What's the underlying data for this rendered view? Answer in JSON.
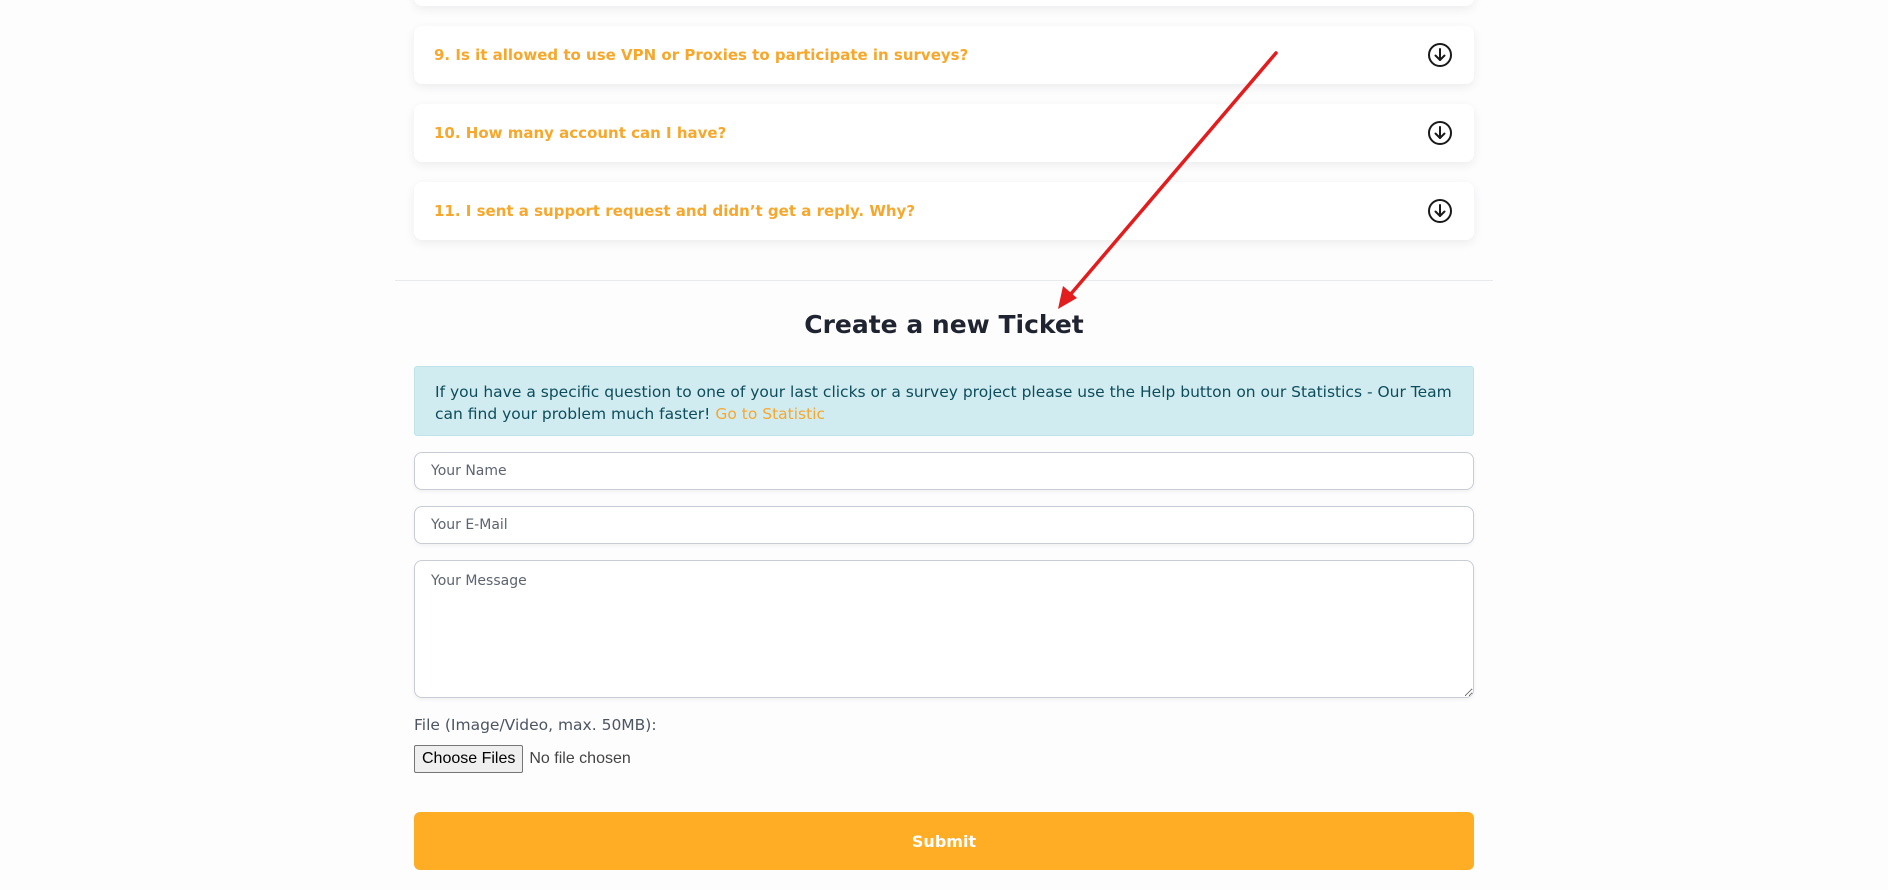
{
  "faq": {
    "items": [
      {
        "question": "9. Is it allowed to use VPN or Proxies to participate in surveys?",
        "icon": "circle-arrow-down-icon"
      },
      {
        "question": "10. How many account can I have?",
        "icon": "circle-arrow-down-icon"
      },
      {
        "question": "11. I sent a support request and didn’t get a reply. Why?",
        "icon": "circle-arrow-down-icon"
      }
    ]
  },
  "ticket": {
    "title": "Create a new Ticket",
    "info_text": "If you have a specific question to one of your last clicks or a survey project please use the Help button on our Statistics - Our Team can find your problem much faster!",
    "info_link": "Go to Statistic",
    "name_placeholder": "Your Name",
    "email_placeholder": "Your E-Mail",
    "message_placeholder": "Your Message",
    "file_label": "File (Image/Video, max. 50MB):",
    "choose_files": "Choose Files",
    "file_status": "No file chosen",
    "submit_label": "Submit"
  },
  "colors": {
    "accent": "#ffad24",
    "faq_text": "#f7a72c",
    "info_bg": "#d1ecf0",
    "annotation": "#e31d1d"
  }
}
